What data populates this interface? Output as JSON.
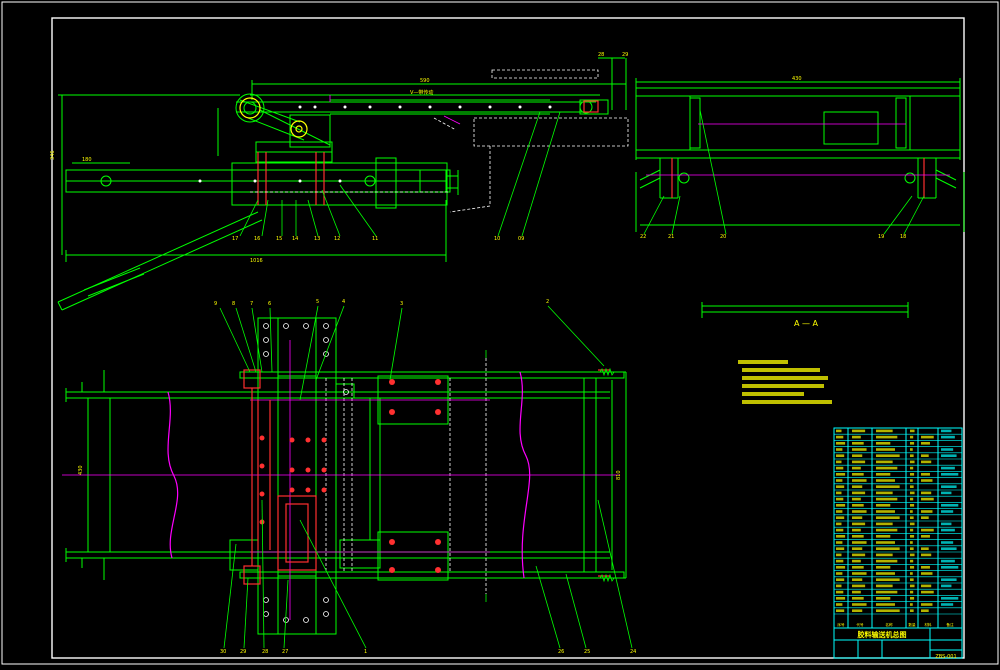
{
  "section_label": "A — A",
  "title_block": {
    "drawing_name": "胶料输送机总图",
    "drawing_no": "ZBS-001",
    "header_cols": [
      "序号",
      "代号",
      "名称",
      "数量",
      "材料",
      "备注"
    ]
  },
  "colors": {
    "background": "#000000",
    "structure": "#00ff00",
    "hidden": "#ffffff",
    "centerline": "#ff00ff",
    "part": "#ff3030",
    "text": "#ffff00",
    "table": "#00ffff"
  }
}
